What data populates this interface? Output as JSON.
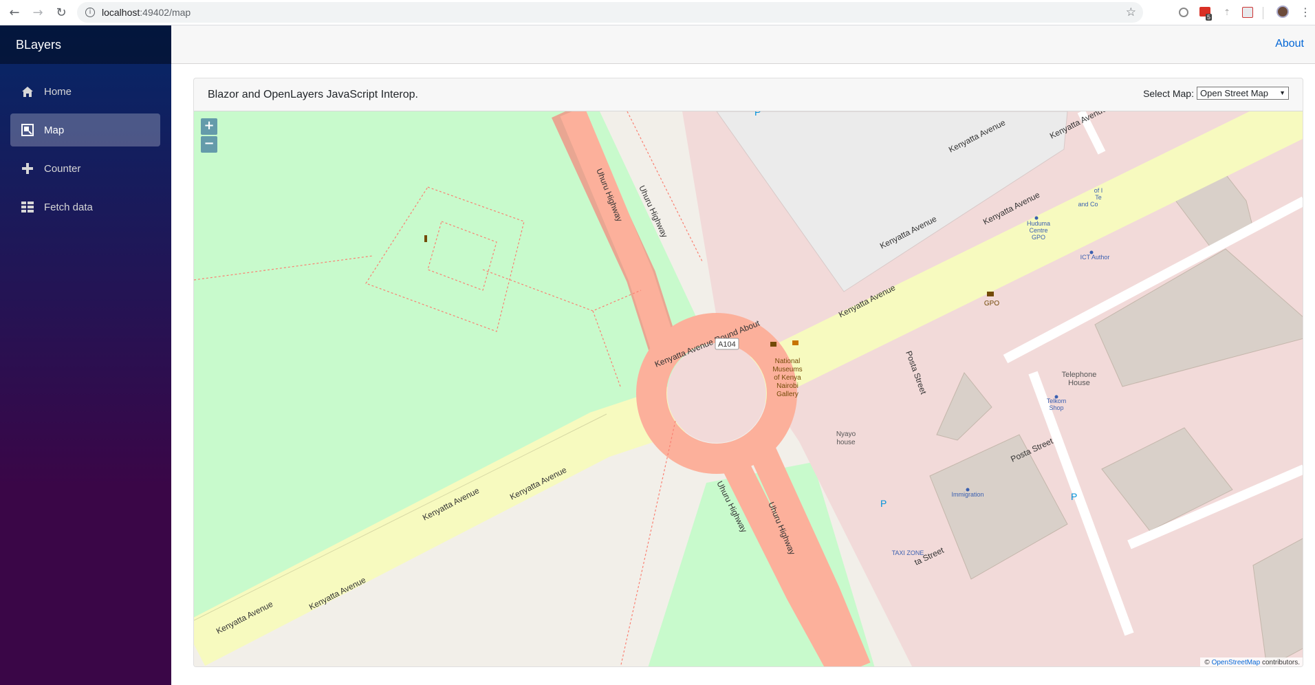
{
  "browser": {
    "url_host": "localhost",
    "url_path": ":49402/map",
    "extension_badge": "5"
  },
  "sidebar": {
    "brand": "BLayers",
    "items": [
      {
        "label": "Home",
        "icon": "home-icon"
      },
      {
        "label": "Map",
        "icon": "map-icon",
        "active": true
      },
      {
        "label": "Counter",
        "icon": "plus-icon"
      },
      {
        "label": "Fetch data",
        "icon": "list-icon"
      }
    ]
  },
  "top_row": {
    "about": "About"
  },
  "card": {
    "title": "Blazor and OpenLayers JavaScript Interop.",
    "select_label": "Select Map:",
    "select_value": "Open Street Map"
  },
  "map": {
    "zoom_in": "+",
    "zoom_out": "−",
    "attribution_prefix": "© ",
    "attribution_link": "OpenStreetMap",
    "attribution_suffix": " contributors.",
    "labels": {
      "uhuru1": "Uhuru Highway",
      "uhuru2": "Uhuru Highway",
      "uhuru3": "Uhuru Highway",
      "uhuru4": "Uhuru Highway",
      "roundabout": "Kenyatta Avenue Round About",
      "ken1": "Kenyatta Avenue",
      "ken2": "Kenyatta Avenue",
      "ken3": "Kenyatta Avenue",
      "ken4": "Kenyatta Avenue",
      "ken5": "Kenyatta Avenue",
      "ken6": "Kenyatta Avenue",
      "ken7": "Kenyatta Avenue",
      "ken8": "Kenyatta Avenue",
      "ken9": "Kenyatta Avenue",
      "posta1": "Posta Street",
      "posta2": "Posta Street",
      "posta3": "ta Street",
      "a104": "A104",
      "museum": [
        "National",
        "Museums",
        "of Kenya",
        "Nairobi",
        "Gallery"
      ],
      "nyayo": [
        "Nyayo",
        "house"
      ],
      "huduma": [
        "Huduma",
        "Centre",
        "GPO"
      ],
      "ict": "ICT Author",
      "gpo": "GPO",
      "telephone": [
        "Telephone",
        "House"
      ],
      "telkom": [
        "Telkom",
        "Shop"
      ],
      "immigration": "Immigration",
      "taxi": "TAXI ZONE",
      "ofi": [
        "of I",
        "Te",
        "and Co"
      ],
      "parking": "P"
    }
  }
}
